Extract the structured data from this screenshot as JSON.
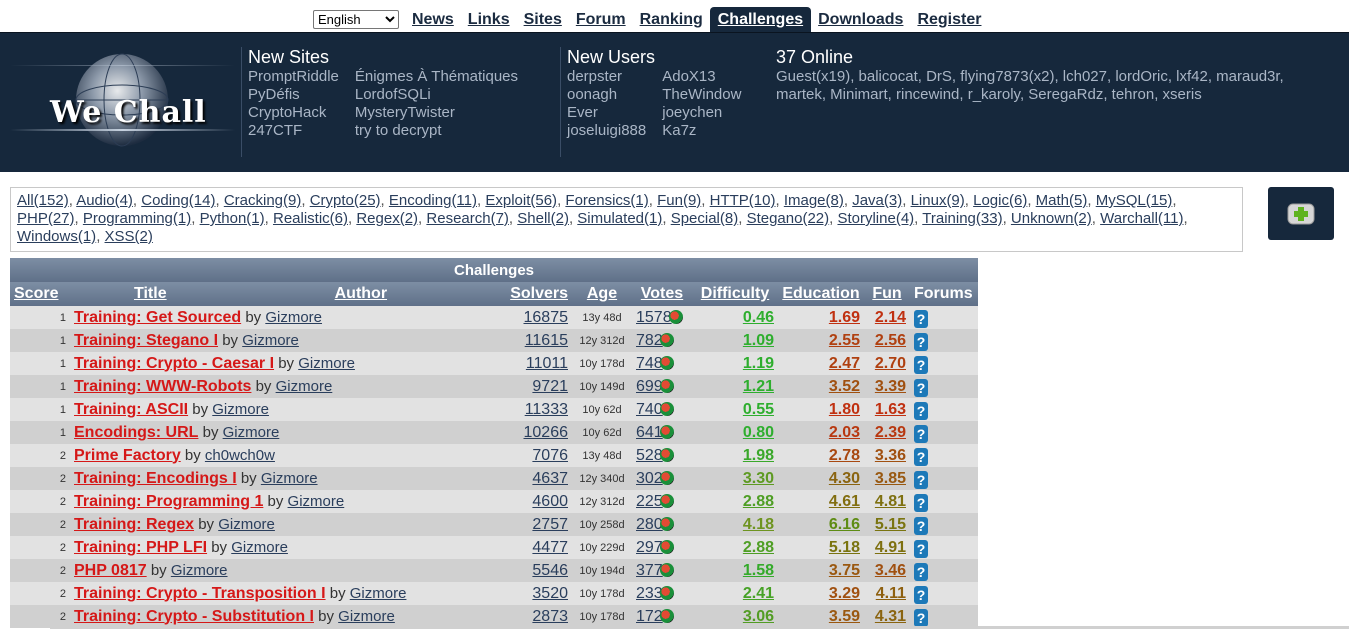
{
  "nav": {
    "language": "English",
    "language_options": [
      "English"
    ],
    "links": [
      {
        "label": "News",
        "active": false
      },
      {
        "label": "Links",
        "active": false
      },
      {
        "label": "Sites",
        "active": false
      },
      {
        "label": "Forum",
        "active": false
      },
      {
        "label": "Ranking",
        "active": false
      },
      {
        "label": "Challenges",
        "active": true
      },
      {
        "label": "Downloads",
        "active": false
      },
      {
        "label": "Register",
        "active": false
      }
    ]
  },
  "header": {
    "logo_text": "We Chall",
    "new_sites": {
      "title": "New Sites",
      "col1": [
        "PromptRiddle",
        "PyDéfis",
        "CryptoHack",
        "247CTF"
      ],
      "col2": [
        "Énigmes À Thématiques",
        "LordofSQLi",
        "MysteryTwister",
        "try to decrypt"
      ]
    },
    "new_users": {
      "title": "New Users",
      "col1": [
        "derpster",
        "oonagh",
        "Ever",
        "joseluigi888"
      ],
      "col2": [
        "AdoX13",
        "TheWindow",
        "joeychen",
        "Ka7z"
      ]
    },
    "online": {
      "title": "37 Online",
      "text": "Guest(x19), balicocat, DrS, flying7873(x2), lch027, lordOric, lxf42, maraud3r, martek, Minimart, rincewind, r_karoly, SeregaRdz, tehron, xseris"
    }
  },
  "tags": [
    "All(152)",
    "Audio(4)",
    "Coding(14)",
    "Cracking(9)",
    "Crypto(25)",
    "Encoding(11)",
    "Exploit(56)",
    "Forensics(1)",
    "Fun(9)",
    "HTTP(10)",
    "Image(8)",
    "Java(3)",
    "Linux(9)",
    "Logic(6)",
    "Math(5)",
    "MySQL(15)",
    "PHP(27)",
    "Programming(1)",
    "Python(1)",
    "Realistic(6)",
    "Regex(2)",
    "Research(7)",
    "Shell(2)",
    "Simulated(1)",
    "Special(8)",
    "Stegano(22)",
    "Storyline(4)",
    "Training(33)",
    "Unknown(2)",
    "Warchall(11)",
    "Windows(1)",
    "XSS(2)"
  ],
  "table": {
    "caption": "Challenges",
    "headers": {
      "score": "Score",
      "title": "Title",
      "author": "Author",
      "solvers": "Solvers",
      "age": "Age",
      "votes": "Votes",
      "difficulty": "Difficulty",
      "education": "Education",
      "fun": "Fun",
      "forums": "Forums"
    },
    "by_word": "by",
    "rows": [
      {
        "score": "1",
        "title": "Training: Get Sourced",
        "author": "Gizmore",
        "solvers": "16875",
        "age": "13y 48d",
        "votes": "1578",
        "difficulty": "0.46",
        "education": "1.69",
        "fun": "2.14",
        "dcol": "#2eae2e",
        "ecol": "#c03010",
        "fcol": "#c03010"
      },
      {
        "score": "1",
        "title": "Training: Stegano I",
        "author": "Gizmore",
        "solvers": "11615",
        "age": "12y 312d",
        "votes": "782",
        "difficulty": "1.09",
        "education": "2.55",
        "fun": "2.56",
        "dcol": "#2eae2e",
        "ecol": "#b04010",
        "fcol": "#b04010"
      },
      {
        "score": "1",
        "title": "Training: Crypto - Caesar I",
        "author": "Gizmore",
        "solvers": "11011",
        "age": "10y 178d",
        "votes": "748",
        "difficulty": "1.19",
        "education": "2.47",
        "fun": "2.70",
        "dcol": "#2eae2e",
        "ecol": "#b04010",
        "fcol": "#b04010"
      },
      {
        "score": "1",
        "title": "Training: WWW-Robots",
        "author": "Gizmore",
        "solvers": "9721",
        "age": "10y 149d",
        "votes": "699",
        "difficulty": "1.21",
        "education": "3.52",
        "fun": "3.39",
        "dcol": "#2eae2e",
        "ecol": "#a05010",
        "fcol": "#a05010"
      },
      {
        "score": "1",
        "title": "Training: ASCII",
        "author": "Gizmore",
        "solvers": "11333",
        "age": "10y 62d",
        "votes": "740",
        "difficulty": "0.55",
        "education": "1.80",
        "fun": "1.63",
        "dcol": "#2eae2e",
        "ecol": "#c03010",
        "fcol": "#c03010"
      },
      {
        "score": "1",
        "title": "Encodings: URL",
        "author": "Gizmore",
        "solvers": "10266",
        "age": "10y 62d",
        "votes": "641",
        "difficulty": "0.80",
        "education": "2.03",
        "fun": "2.39",
        "dcol": "#2eae2e",
        "ecol": "#b83810",
        "fcol": "#b83810"
      },
      {
        "score": "2",
        "title": "Prime Factory",
        "author": "ch0wch0w",
        "solvers": "7076",
        "age": "13y 48d",
        "votes": "528",
        "difficulty": "1.98",
        "education": "2.78",
        "fun": "3.36",
        "dcol": "#3aa82a",
        "ecol": "#a84810",
        "fcol": "#a05010"
      },
      {
        "score": "2",
        "title": "Training: Encodings I",
        "author": "Gizmore",
        "solvers": "4637",
        "age": "12y 340d",
        "votes": "302",
        "difficulty": "3.30",
        "education": "4.30",
        "fun": "3.85",
        "dcol": "#5e9a22",
        "ecol": "#8a6410",
        "fcol": "#985810"
      },
      {
        "score": "2",
        "title": "Training: Programming 1",
        "author": "Gizmore",
        "solvers": "4600",
        "age": "12y 312d",
        "votes": "225",
        "difficulty": "2.88",
        "education": "4.61",
        "fun": "4.81",
        "dcol": "#4e9e24",
        "ecol": "#826e10",
        "fcol": "#7e7010"
      },
      {
        "score": "2",
        "title": "Training: Regex",
        "author": "Gizmore",
        "solvers": "2757",
        "age": "10y 258d",
        "votes": "280",
        "difficulty": "4.18",
        "education": "6.16",
        "fun": "5.15",
        "dcol": "#6e9420",
        "ecol": "#5e8c14",
        "fcol": "#7a7410"
      },
      {
        "score": "2",
        "title": "Training: PHP LFI",
        "author": "Gizmore",
        "solvers": "4477",
        "age": "10y 229d",
        "votes": "297",
        "difficulty": "2.88",
        "education": "5.18",
        "fun": "4.91",
        "dcol": "#4e9e24",
        "ecol": "#7a7410",
        "fcol": "#7e7010"
      },
      {
        "score": "2",
        "title": "PHP 0817",
        "author": "Gizmore",
        "solvers": "5546",
        "age": "10y 194d",
        "votes": "377",
        "difficulty": "1.58",
        "education": "3.75",
        "fun": "3.46",
        "dcol": "#34aa2a",
        "ecol": "#9a5810",
        "fcol": "#a05010"
      },
      {
        "score": "2",
        "title": "Training: Crypto - Transposition I",
        "author": "Gizmore",
        "solvers": "3520",
        "age": "10y 178d",
        "votes": "233",
        "difficulty": "2.41",
        "education": "3.29",
        "fun": "4.11",
        "dcol": "#46a226",
        "ecol": "#a05010",
        "fcol": "#8e6010"
      },
      {
        "score": "2",
        "title": "Training: Crypto - Substitution I",
        "author": "Gizmore",
        "solvers": "2873",
        "age": "10y 178d",
        "votes": "172",
        "difficulty": "3.06",
        "education": "3.59",
        "fun": "4.31",
        "dcol": "#529c24",
        "ecol": "#9a5810",
        "fcol": "#8a6410"
      }
    ]
  }
}
